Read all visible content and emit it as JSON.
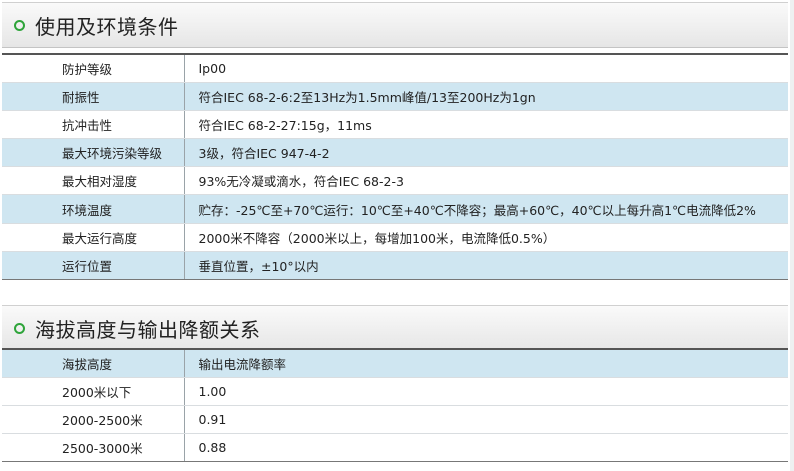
{
  "section1": {
    "title": "使用及环境条件",
    "rows": [
      {
        "key": "防护等级",
        "value": "Ip00"
      },
      {
        "key": "耐振性",
        "value": "符合IEC 68-2-6:2至13Hz为1.5mm峰值/13至200Hz为1gn"
      },
      {
        "key": "抗冲击性",
        "value": "符合IEC 68-2-27:15g，11ms"
      },
      {
        "key": "最大环境污染等级",
        "value": "3级，符合IEC 947-4-2"
      },
      {
        "key": "最大相对湿度",
        "value": "93%无冷凝或滴水，符合IEC 68-2-3"
      },
      {
        "key": "环境温度",
        "value": "贮存：-25℃至+70℃运行：10℃至+40℃不降容；最高+60℃，40℃以上每升高1℃电流降低2%"
      },
      {
        "key": "最大运行高度",
        "value": "2000米不降容（2000米以上，每增加100米，电流降低0.5%）"
      },
      {
        "key": "运行位置",
        "value": "垂直位置，±10°以内"
      }
    ]
  },
  "section2": {
    "title": "海拔高度与输出降额关系",
    "header": {
      "key": "海拔高度",
      "value": "输出电流降额率"
    },
    "rows": [
      {
        "key": "2000米以下",
        "value": "1.00"
      },
      {
        "key": "2000-2500米",
        "value": "0.91"
      },
      {
        "key": "2500-3000米",
        "value": "0.88"
      }
    ]
  },
  "colors": {
    "accent": "#2ea43a",
    "row_alt": "#cfe6f1"
  }
}
